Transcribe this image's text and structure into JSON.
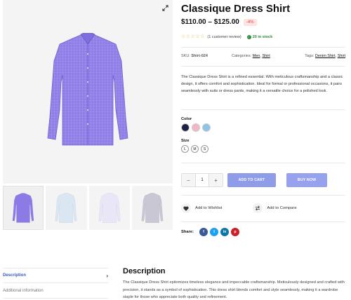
{
  "product": {
    "title": "Classique Dress Shirt",
    "price_range": "$110.00 – $125.00",
    "discount": "-4%",
    "review_count": "(1 customer review)",
    "stock": "20 in stock",
    "rating": 0,
    "rating_max": 5
  },
  "meta": {
    "sku_label": "SKU:",
    "sku_value": "Shirt-024",
    "categories_label": "Categories:",
    "categories": [
      "Men",
      "Shirt"
    ],
    "tags_label": "Tags:",
    "tags": [
      "Denim Shirt",
      "Shirt"
    ]
  },
  "short_description": "The Classique Dress Shirt is a refined essential. With meticulous craftsmanship and a classic design, it offers comfort and sophistication. Ideal for formal or professional occasions, it pairs seamlessly with suits or dress pants, making it a versatile choice for a polished look.",
  "options": {
    "color_label": "Color",
    "colors": [
      "#1c2140",
      "#f2b8c6",
      "#8fc4e8"
    ],
    "size_label": "Size",
    "sizes": [
      "L",
      "M",
      "S"
    ]
  },
  "cart": {
    "minus": "−",
    "quantity": "1",
    "plus": "+",
    "add_to_cart": "ADD TO CART",
    "buy_now": "BUY NOW"
  },
  "actions": {
    "wishlist": "Add to Wishlist",
    "compare": "Add to Compare"
  },
  "share": {
    "label": "Share:",
    "networks": [
      {
        "letter": "f",
        "color": "#3b5998"
      },
      {
        "letter": "t",
        "color": "#1da1f2"
      },
      {
        "letter": "in",
        "color": "#0e76a8"
      },
      {
        "letter": "p",
        "color": "#cb2027"
      }
    ]
  },
  "tabs": [
    {
      "label": "Description",
      "arrow": "›"
    },
    {
      "label": "Additional information",
      "arrow": ""
    }
  ],
  "description": {
    "heading": "Description",
    "body": "The Classique Dress Shirt epitomizes timeless elegance and impeccable craftsmanship. Meticulously designed and crafted with precision, it stands as a symbol of sophistication. This dress shirt blends comfort and style seamlessly, making it a wardrobe staple for those who appreciate both quality and refinement."
  },
  "colors": {
    "accent": "#3b5bb5",
    "button": "#8f9ce8",
    "star": "#e3a93a",
    "stock": "#2f8a3e",
    "discount": "#e0453d"
  }
}
